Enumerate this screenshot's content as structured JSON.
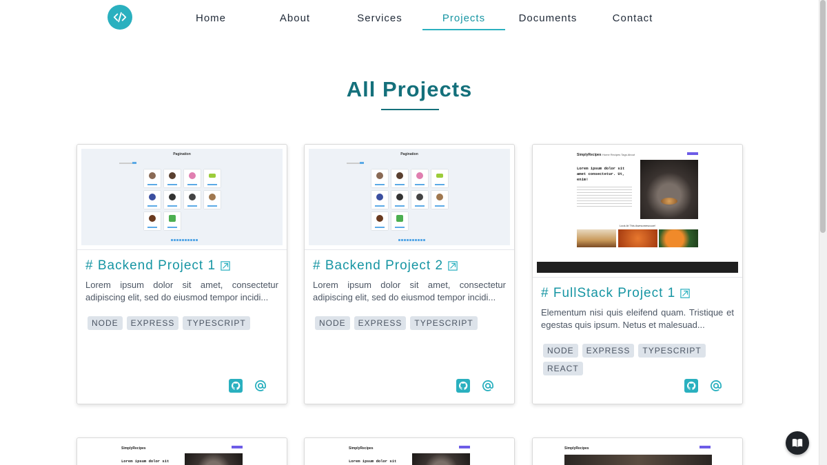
{
  "nav": {
    "logo_icon": "code-icon",
    "items": [
      "Home",
      "About",
      "Services",
      "Projects",
      "Documents",
      "Contact"
    ],
    "active": "Projects"
  },
  "page": {
    "title": "All Projects"
  },
  "projects": [
    {
      "title": "# Backend Project 1",
      "description": "Lorem ipsum dolor sit amet, consectetur adipiscing elit, sed do eiusmod tempor incidi...",
      "tags": [
        "NODE",
        "EXPRESS",
        "TYPESCRIPT"
      ],
      "thumb": {
        "kind": "pagination",
        "heading": "Pagination"
      }
    },
    {
      "title": "# Backend Project 2",
      "description": "Lorem ipsum dolor sit amet, consectetur adipiscing elit, sed do eiusmod tempor incidi...",
      "tags": [
        "NODE",
        "EXPRESS",
        "TYPESCRIPT"
      ],
      "thumb": {
        "kind": "pagination",
        "heading": "Pagination"
      }
    },
    {
      "title": "# FullStack Project 1",
      "description": "Elementum nisi quis eleifend quam. Tristique et egestas quis ipsum. Netus et malesuad...",
      "tags": [
        "NODE",
        "EXPRESS",
        "TYPESCRIPT",
        "REACT"
      ],
      "thumb": {
        "kind": "recipes",
        "logo": "SimplyRecipes",
        "nav": "Home  Recipes  Tags  About",
        "headline": "Lorem ipsum dolor sit amet consectetur. Ut, enim!",
        "subheading": "Look At This Awesomesouce!"
      }
    }
  ],
  "next_row_logos": [
    "SimplyRecipes",
    "SimplyRecipes",
    "SimplyRecipes"
  ],
  "next_row_headlines": [
    "Lorem ipsum dolor sit",
    "Lorem ipsum dolor sit"
  ],
  "colors": {
    "accent": "#2ab0bf",
    "title": "#14707b",
    "tag_bg": "#dde3ea"
  },
  "floating_button": {
    "icon": "book-icon"
  }
}
